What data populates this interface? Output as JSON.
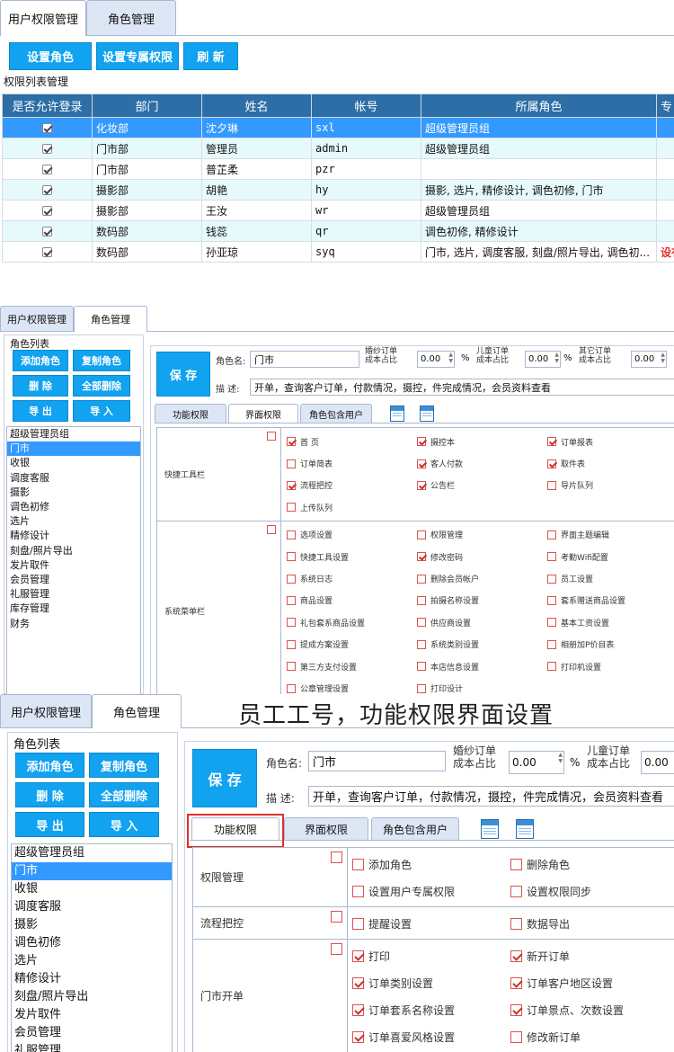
{
  "panel1": {
    "tabs": [
      {
        "label": "用户权限管理",
        "active": true
      },
      {
        "label": "角色管理",
        "active": false
      }
    ],
    "buttons": [
      "设置角色",
      "设置专属权限",
      "刷 新"
    ],
    "section_title": "权限列表管理",
    "columns": [
      "是否允许登录",
      "部门",
      "姓名",
      "帐号",
      "所属角色",
      "专"
    ],
    "rows": [
      {
        "checked": true,
        "dept": "化妆部",
        "name": "沈夕琳",
        "account": "sxl",
        "role": "超级管理员组",
        "extra": ""
      },
      {
        "checked": true,
        "dept": "门市部",
        "name": "管理员",
        "account": "admin",
        "role": "超级管理员组",
        "extra": ""
      },
      {
        "checked": true,
        "dept": "门市部",
        "name": "普芷柔",
        "account": "pzr",
        "role": "",
        "extra": ""
      },
      {
        "checked": true,
        "dept": "摄影部",
        "name": "胡艳",
        "account": "hy",
        "role": "摄影, 选片, 精修设计, 调色初修, 门市",
        "extra": ""
      },
      {
        "checked": true,
        "dept": "摄影部",
        "name": "王汝",
        "account": "wr",
        "role": "超级管理员组",
        "extra": ""
      },
      {
        "checked": true,
        "dept": "数码部",
        "name": "钱蕊",
        "account": "qr",
        "role": "调色初修, 精修设计",
        "extra": ""
      },
      {
        "checked": true,
        "dept": "数码部",
        "name": "孙亚琼",
        "account": "syq",
        "role": "门市, 选片, 调度客服, 刻盘/照片导出, 调色初...",
        "extra": "设有"
      }
    ]
  },
  "panel2": {
    "tabs": [
      {
        "label": "用户权限管理",
        "active": false
      },
      {
        "label": "角色管理",
        "active": true
      }
    ],
    "role_list_title": "角色列表",
    "buttons": [
      "添加角色",
      "复制角色",
      "删 除",
      "全部删除",
      "导 出",
      "导 入"
    ],
    "roles": [
      "超级管理员组",
      "门市",
      "收银",
      "调度客服",
      "摄影",
      "调色初修",
      "选片",
      "精修设计",
      "刻盘/照片导出",
      "发片取件",
      "会员管理",
      "礼服管理",
      "库存管理",
      "财务"
    ],
    "selected_role": "门市",
    "save_label": "保 存",
    "role_name_label": "角色名:",
    "role_name_value": "门市",
    "ratio_labels": [
      [
        "婚纱订单",
        "成本占比"
      ],
      [
        "儿童订单",
        "成本占比"
      ],
      [
        "其它订单",
        "成本占比"
      ]
    ],
    "ratio_values": [
      "0.00",
      "0.00",
      "0.00"
    ],
    "percent": "%",
    "desc_label": "描  述:",
    "desc_value": "开单，查询客户订单，付款情况，摄控，件完成情况，会员资料查看",
    "subtabs": [
      {
        "label": "功能权限",
        "active": false
      },
      {
        "label": "界面权限",
        "active": true
      },
      {
        "label": "角色包含用户",
        "active": false
      }
    ],
    "groups": [
      {
        "name": "快捷工具栏",
        "items": [
          {
            "label": "首  页",
            "checked": true
          },
          {
            "label": "摄控本",
            "checked": true
          },
          {
            "label": "订单报表",
            "checked": true
          },
          {
            "label": "订单简表",
            "checked": false
          },
          {
            "label": "客人付款",
            "checked": true
          },
          {
            "label": "取件表",
            "checked": true
          },
          {
            "label": "流程把控",
            "checked": true
          },
          {
            "label": "公告栏",
            "checked": true
          },
          {
            "label": "导片队列",
            "checked": false
          },
          {
            "label": "上传队列",
            "checked": false
          }
        ]
      },
      {
        "name": "系统菜单栏",
        "items": [
          {
            "label": "选项设置",
            "checked": false
          },
          {
            "label": "权限管理",
            "checked": false
          },
          {
            "label": "界面主题编辑",
            "checked": false
          },
          {
            "label": "快捷工具设置",
            "checked": false
          },
          {
            "label": "修改密码",
            "checked": true
          },
          {
            "label": "考勤Wifi配置",
            "checked": false
          },
          {
            "label": "系统日志",
            "checked": false
          },
          {
            "label": "删除会员帐户",
            "checked": false
          },
          {
            "label": "员工设置",
            "checked": false
          },
          {
            "label": "商品设置",
            "checked": false
          },
          {
            "label": "拍摄名称设置",
            "checked": false
          },
          {
            "label": "套系赠送商品设置",
            "checked": false
          },
          {
            "label": "礼包套系商品设置",
            "checked": false
          },
          {
            "label": "供应商设置",
            "checked": false
          },
          {
            "label": "基本工资设置",
            "checked": false
          },
          {
            "label": "提成方案设置",
            "checked": false
          },
          {
            "label": "系统类别设置",
            "checked": false
          },
          {
            "label": "相册加P价目表",
            "checked": false
          },
          {
            "label": "第三方支付设置",
            "checked": false
          },
          {
            "label": "本店信息设置",
            "checked": false
          },
          {
            "label": "打印机设置",
            "checked": false
          },
          {
            "label": "公章管理设置",
            "checked": false
          },
          {
            "label": "打印设计",
            "checked": false
          }
        ]
      }
    ]
  },
  "panel3": {
    "tabs": [
      {
        "label": "用户权限管理",
        "active": false
      },
      {
        "label": "角色管理",
        "active": true
      }
    ],
    "banner": "员工工号，功能权限界面设置",
    "role_list_title": "角色列表",
    "buttons": [
      "添加角色",
      "复制角色",
      "删 除",
      "全部删除",
      "导 出",
      "导 入"
    ],
    "roles": [
      "超级管理员组",
      "门市",
      "收银",
      "调度客服",
      "摄影",
      "调色初修",
      "选片",
      "精修设计",
      "刻盘/照片导出",
      "发片取件",
      "会员管理",
      "礼服管理"
    ],
    "selected_role": "门市",
    "save_label": "保 存",
    "role_name_label": "角色名:",
    "role_name_value": "门市",
    "ratio_labels": [
      [
        "婚纱订单",
        "成本占比"
      ],
      [
        "儿童订单",
        "成本占比"
      ]
    ],
    "ratio_values": [
      "0.00",
      "0.00"
    ],
    "percent": "%",
    "desc_label": "描  述:",
    "desc_value": "开单，查询客户订单，付款情况，摄控，件完成情况，会员资料查看",
    "subtabs": [
      {
        "label": "功能权限",
        "active": true
      },
      {
        "label": "界面权限",
        "active": false
      },
      {
        "label": "角色包含用户",
        "active": false
      }
    ],
    "highlight_color": "#e0302a",
    "groups": [
      {
        "name": "权限管理",
        "items": [
          {
            "label": "添加角色",
            "checked": false
          },
          {
            "label": "删除角色",
            "checked": false
          },
          {
            "label": "设置用户专属权限",
            "checked": false
          },
          {
            "label": "设置权限同步",
            "checked": false
          }
        ]
      },
      {
        "name": "流程把控",
        "items": [
          {
            "label": "提醒设置",
            "checked": false
          },
          {
            "label": "数据导出",
            "checked": false
          }
        ]
      },
      {
        "name": "门市开单",
        "items": [
          {
            "label": "打印",
            "checked": true
          },
          {
            "label": "新开订单",
            "checked": true
          },
          {
            "label": "订单类别设置",
            "checked": true
          },
          {
            "label": "订单客户地区设置",
            "checked": true
          },
          {
            "label": "订单套系名称设置",
            "checked": true
          },
          {
            "label": "订单景点、次数设置",
            "checked": true
          },
          {
            "label": "订单喜爱风格设置",
            "checked": true
          },
          {
            "label": "修改新订单",
            "checked": false
          }
        ]
      }
    ]
  },
  "colors": {
    "accent": "#11a2f0",
    "header": "#2c6ea5",
    "selected": "#3399ff",
    "alt_row": "#e6fafc",
    "red": "#e0302a"
  }
}
